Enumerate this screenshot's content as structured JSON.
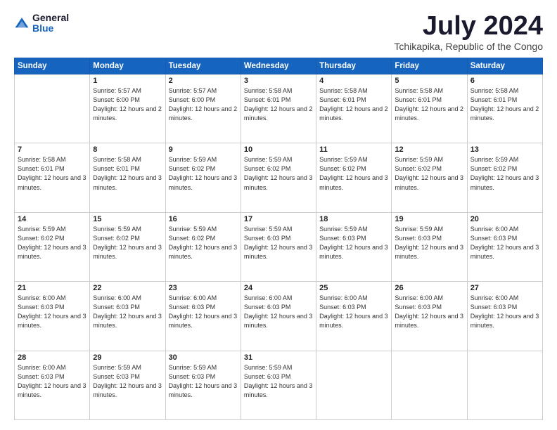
{
  "logo": {
    "general": "General",
    "blue": "Blue"
  },
  "title": "July 2024",
  "location": "Tchikapika, Republic of the Congo",
  "days_of_week": [
    "Sunday",
    "Monday",
    "Tuesday",
    "Wednesday",
    "Thursday",
    "Friday",
    "Saturday"
  ],
  "weeks": [
    [
      {
        "day": null,
        "info": null
      },
      {
        "day": "1",
        "sunrise": "5:57 AM",
        "sunset": "6:00 PM",
        "daylight": "12 hours and 2 minutes."
      },
      {
        "day": "2",
        "sunrise": "5:57 AM",
        "sunset": "6:00 PM",
        "daylight": "12 hours and 2 minutes."
      },
      {
        "day": "3",
        "sunrise": "5:58 AM",
        "sunset": "6:01 PM",
        "daylight": "12 hours and 2 minutes."
      },
      {
        "day": "4",
        "sunrise": "5:58 AM",
        "sunset": "6:01 PM",
        "daylight": "12 hours and 2 minutes."
      },
      {
        "day": "5",
        "sunrise": "5:58 AM",
        "sunset": "6:01 PM",
        "daylight": "12 hours and 2 minutes."
      },
      {
        "day": "6",
        "sunrise": "5:58 AM",
        "sunset": "6:01 PM",
        "daylight": "12 hours and 2 minutes."
      }
    ],
    [
      {
        "day": "7",
        "sunrise": "5:58 AM",
        "sunset": "6:01 PM",
        "daylight": "12 hours and 3 minutes."
      },
      {
        "day": "8",
        "sunrise": "5:58 AM",
        "sunset": "6:01 PM",
        "daylight": "12 hours and 3 minutes."
      },
      {
        "day": "9",
        "sunrise": "5:59 AM",
        "sunset": "6:02 PM",
        "daylight": "12 hours and 3 minutes."
      },
      {
        "day": "10",
        "sunrise": "5:59 AM",
        "sunset": "6:02 PM",
        "daylight": "12 hours and 3 minutes."
      },
      {
        "day": "11",
        "sunrise": "5:59 AM",
        "sunset": "6:02 PM",
        "daylight": "12 hours and 3 minutes."
      },
      {
        "day": "12",
        "sunrise": "5:59 AM",
        "sunset": "6:02 PM",
        "daylight": "12 hours and 3 minutes."
      },
      {
        "day": "13",
        "sunrise": "5:59 AM",
        "sunset": "6:02 PM",
        "daylight": "12 hours and 3 minutes."
      }
    ],
    [
      {
        "day": "14",
        "sunrise": "5:59 AM",
        "sunset": "6:02 PM",
        "daylight": "12 hours and 3 minutes."
      },
      {
        "day": "15",
        "sunrise": "5:59 AM",
        "sunset": "6:02 PM",
        "daylight": "12 hours and 3 minutes."
      },
      {
        "day": "16",
        "sunrise": "5:59 AM",
        "sunset": "6:02 PM",
        "daylight": "12 hours and 3 minutes."
      },
      {
        "day": "17",
        "sunrise": "5:59 AM",
        "sunset": "6:03 PM",
        "daylight": "12 hours and 3 minutes."
      },
      {
        "day": "18",
        "sunrise": "5:59 AM",
        "sunset": "6:03 PM",
        "daylight": "12 hours and 3 minutes."
      },
      {
        "day": "19",
        "sunrise": "5:59 AM",
        "sunset": "6:03 PM",
        "daylight": "12 hours and 3 minutes."
      },
      {
        "day": "20",
        "sunrise": "6:00 AM",
        "sunset": "6:03 PM",
        "daylight": "12 hours and 3 minutes."
      }
    ],
    [
      {
        "day": "21",
        "sunrise": "6:00 AM",
        "sunset": "6:03 PM",
        "daylight": "12 hours and 3 minutes."
      },
      {
        "day": "22",
        "sunrise": "6:00 AM",
        "sunset": "6:03 PM",
        "daylight": "12 hours and 3 minutes."
      },
      {
        "day": "23",
        "sunrise": "6:00 AM",
        "sunset": "6:03 PM",
        "daylight": "12 hours and 3 minutes."
      },
      {
        "day": "24",
        "sunrise": "6:00 AM",
        "sunset": "6:03 PM",
        "daylight": "12 hours and 3 minutes."
      },
      {
        "day": "25",
        "sunrise": "6:00 AM",
        "sunset": "6:03 PM",
        "daylight": "12 hours and 3 minutes."
      },
      {
        "day": "26",
        "sunrise": "6:00 AM",
        "sunset": "6:03 PM",
        "daylight": "12 hours and 3 minutes."
      },
      {
        "day": "27",
        "sunrise": "6:00 AM",
        "sunset": "6:03 PM",
        "daylight": "12 hours and 3 minutes."
      }
    ],
    [
      {
        "day": "28",
        "sunrise": "6:00 AM",
        "sunset": "6:03 PM",
        "daylight": "12 hours and 3 minutes."
      },
      {
        "day": "29",
        "sunrise": "5:59 AM",
        "sunset": "6:03 PM",
        "daylight": "12 hours and 3 minutes."
      },
      {
        "day": "30",
        "sunrise": "5:59 AM",
        "sunset": "6:03 PM",
        "daylight": "12 hours and 3 minutes."
      },
      {
        "day": "31",
        "sunrise": "5:59 AM",
        "sunset": "6:03 PM",
        "daylight": "12 hours and 3 minutes."
      },
      {
        "day": null,
        "info": null
      },
      {
        "day": null,
        "info": null
      },
      {
        "day": null,
        "info": null
      }
    ]
  ],
  "labels": {
    "sunrise": "Sunrise:",
    "sunset": "Sunset:",
    "daylight": "Daylight:"
  }
}
